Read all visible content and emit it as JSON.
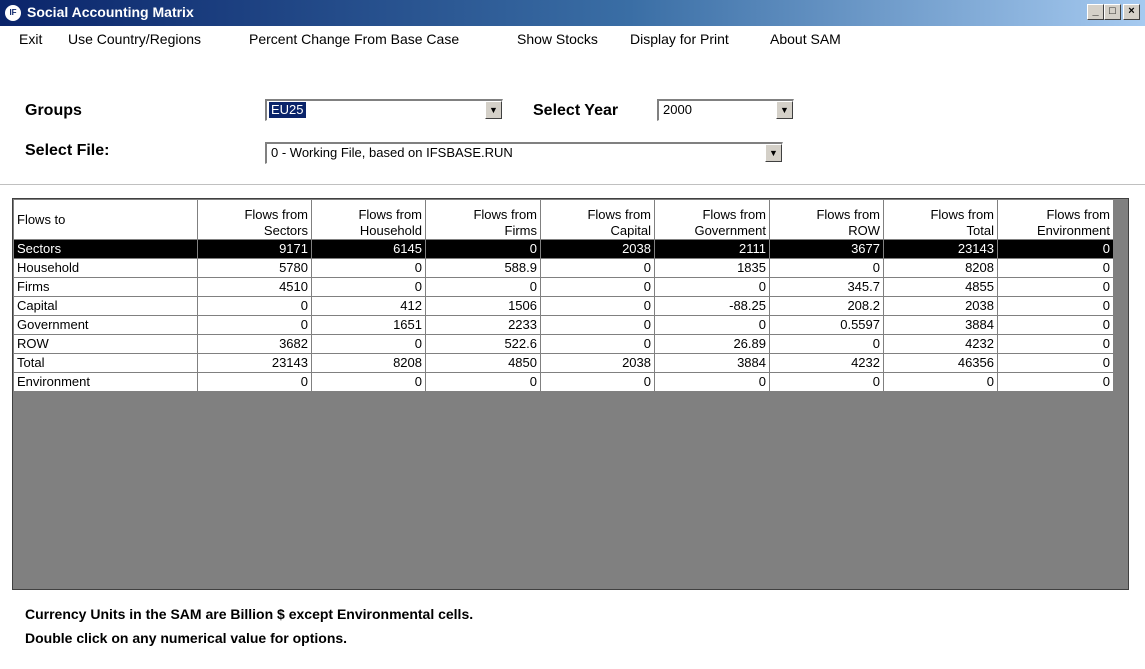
{
  "window": {
    "title": "Social Accounting Matrix",
    "icon_text": "IF",
    "controls": [
      "_",
      "□",
      "×"
    ]
  },
  "menu": {
    "items": [
      "Exit",
      "Use Country/Regions",
      "Percent Change From Base Case",
      "Show Stocks",
      "Display for Print",
      "About SAM"
    ]
  },
  "form": {
    "groups_label": "Groups",
    "groups_value": "EU25",
    "year_label": "Select Year",
    "year_value": "2000",
    "file_label": "Select File:",
    "file_value": "0 - Working File, based on IFSBASE.RUN"
  },
  "table": {
    "corner_header": "Flows to",
    "columns": [
      [
        "Flows from",
        "Sectors"
      ],
      [
        "Flows from",
        "Household"
      ],
      [
        "Flows from",
        "Firms"
      ],
      [
        "Flows from",
        "Capital"
      ],
      [
        "Flows from",
        "Government"
      ],
      [
        "Flows from",
        "ROW"
      ],
      [
        "Flows from",
        "Total"
      ],
      [
        "Flows from",
        "Environment"
      ]
    ],
    "rows": [
      {
        "label": "Sectors",
        "values": [
          "9171",
          "6145",
          "0",
          "2038",
          "2111",
          "3677",
          "23143",
          "0"
        ]
      },
      {
        "label": "Household",
        "values": [
          "5780",
          "0",
          "588.9",
          "0",
          "1835",
          "0",
          "8208",
          "0"
        ]
      },
      {
        "label": "Firms",
        "values": [
          "4510",
          "0",
          "0",
          "0",
          "0",
          "345.7",
          "4855",
          "0"
        ]
      },
      {
        "label": "Capital",
        "values": [
          "0",
          "412",
          "1506",
          "0",
          "-88.25",
          "208.2",
          "2038",
          "0"
        ]
      },
      {
        "label": "Government",
        "values": [
          "0",
          "1651",
          "2233",
          "0",
          "0",
          "0.5597",
          "3884",
          "0"
        ]
      },
      {
        "label": "ROW",
        "values": [
          "3682",
          "0",
          "522.6",
          "0",
          "26.89",
          "0",
          "4232",
          "0"
        ]
      },
      {
        "label": "Total",
        "values": [
          "23143",
          "8208",
          "4850",
          "2038",
          "3884",
          "4232",
          "46356",
          "0"
        ]
      },
      {
        "label": "Environment",
        "values": [
          "0",
          "0",
          "0",
          "0",
          "0",
          "0",
          "0",
          "0"
        ]
      }
    ],
    "selected_row": 0
  },
  "footer": {
    "line1": "Currency Units in the SAM are Billion $ except Environmental cells.",
    "line2": "Double click on any numerical value for options."
  },
  "colors": {
    "title_bar_start": "#0a246a",
    "selection": "#0a246a",
    "selected_row_bg": "#000000"
  }
}
